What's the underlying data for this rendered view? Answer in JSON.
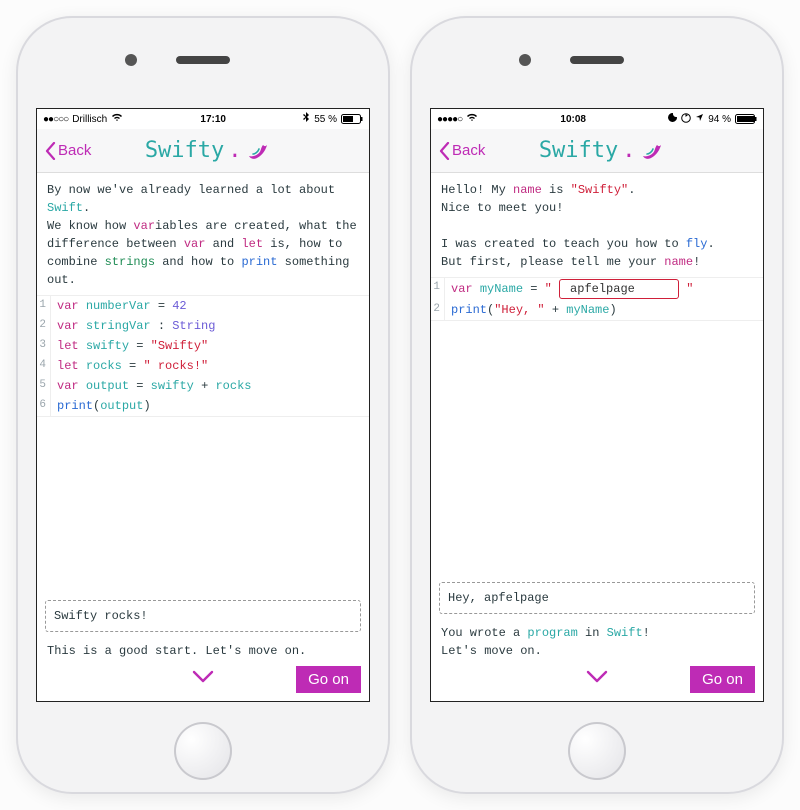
{
  "app": {
    "name": "Swifty",
    "dot": "."
  },
  "nav": {
    "back": "Back"
  },
  "phones": [
    {
      "status": {
        "carrier": "Drillisch",
        "time": "17:10",
        "battery": "55 %",
        "signal_filled": 2,
        "extras": "bluetooth"
      },
      "intro": {
        "line1_pre": "By now we've already learned a lot about ",
        "swift": "Swift",
        "line1_post": ".",
        "var_pre": "We know how ",
        "var": "var",
        "var_mid": "iables are created, what the difference between ",
        "var2": "var",
        "and": " and ",
        "let": "let",
        "let_post": " is, how to combine ",
        "strings": "strings",
        "howto": " and how to ",
        "print": "print",
        "rest": " something out."
      },
      "code": [
        {
          "n": "1",
          "html": "<span class='kw'>var</span> <span class='ident'>numberVar</span> <span class='op'>=</span> <span class='typ'>42</span>"
        },
        {
          "n": "2",
          "html": "<span class='kw'>var</span> <span class='ident'>stringVar</span> <span class='op'>:</span> <span class='typ'>String</span>"
        },
        {
          "n": "3",
          "html": "<span class='kw'>let</span> <span class='ident'>swifty</span> <span class='op'>=</span> <span class='strl'>\"Swifty\"</span>"
        },
        {
          "n": "4",
          "html": "<span class='kw'>let</span> <span class='ident'>rocks</span> <span class='op'>=</span> <span class='strl'>\" rocks!\"</span>"
        },
        {
          "n": "5",
          "html": "<span class='kw'>var</span> <span class='ident'>output</span> <span class='op'>=</span> <span class='ident'>swifty</span> <span class='op'>+</span> <span class='ident'>rocks</span>"
        },
        {
          "n": "6",
          "html": "<span class='fn'>print</span>(<span class='ident'>output</span>)"
        }
      ],
      "console": "Swifty rocks!",
      "feedback": {
        "text": "This is a good start. Let's move on."
      },
      "go": "Go on"
    },
    {
      "status": {
        "carrier": "",
        "time": "10:08",
        "battery": "94 %",
        "signal_filled": 4,
        "extras": "moon-loc"
      },
      "intro": {
        "hello_pre": "Hello! My ",
        "name": "name",
        "hello_mid": " is ",
        "swifty_str": "\"Swifty\"",
        "hello_post": ".",
        "nice": "Nice to meet you!",
        "l3_pre": "I was created to teach you how to ",
        "fly": "fly",
        "l3_post": ".",
        "l4_pre": "But first, please tell me your ",
        "name2": "name",
        "l4_post": "!"
      },
      "code": [
        {
          "n": "1",
          "html": "<span class='kw'>var</span> <span class='ident'>myName</span> <span class='op'>=</span> <span class='strl'>\"</span> <span class='input-inline' data-name='name-input' data-interactable='true'>apfelpage</span> <span class='strl'>\"</span>"
        },
        {
          "n": "2",
          "html": "<span class='fn'>print</span>(<span class='strl'>\"Hey, \"</span> <span class='op'>+</span> <span class='ident'>myName</span>)"
        }
      ],
      "console": "Hey, apfelpage",
      "feedback": {
        "pre": "You wrote a ",
        "prog": "program",
        "mid": " in ",
        "swift": "Swift",
        "post": "!",
        "line2": "Let's move on."
      },
      "go": "Go on"
    }
  ]
}
